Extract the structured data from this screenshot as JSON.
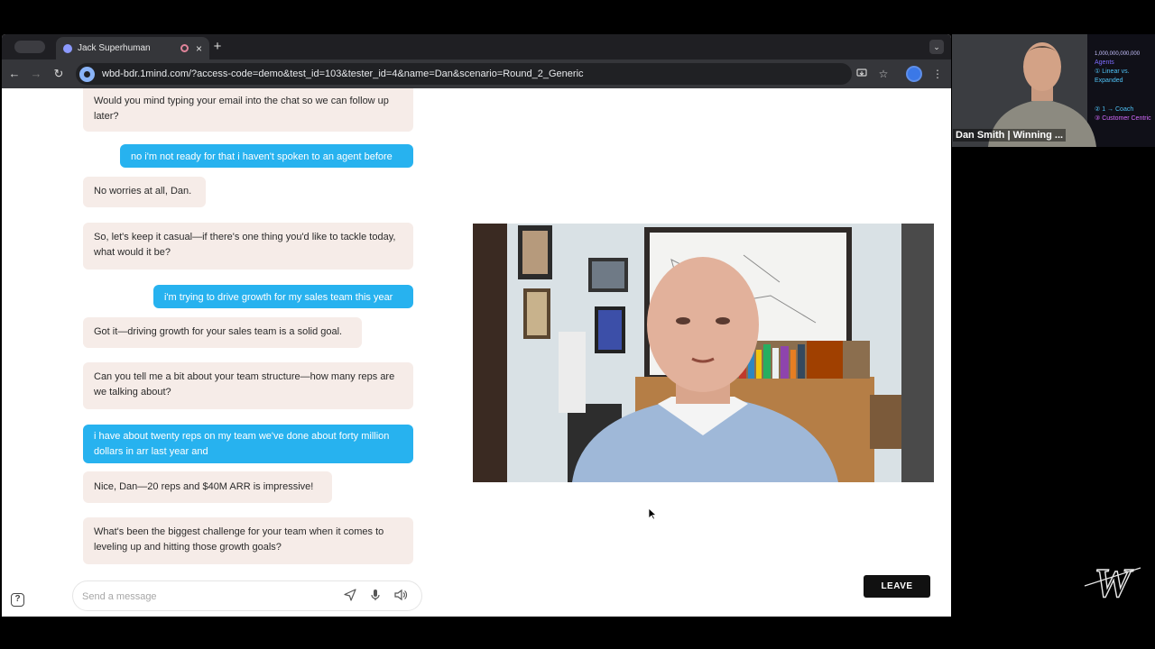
{
  "browser": {
    "tab_title": "Jack Superhuman",
    "tab_close": "×",
    "new_tab": "+",
    "url": "wbd-bdr.1mind.com/?access-code=demo&test_id=103&tester_id=4&name=Dan&scenario=Round_2_Generic"
  },
  "chat": {
    "messages": [
      {
        "role": "bot",
        "text": "Would you mind typing your email into the chat so we can follow up later?"
      },
      {
        "role": "user",
        "text": "no i'm not ready for that i haven't spoken to an agent before"
      },
      {
        "role": "bot",
        "text": "No worries at all, Dan."
      },
      {
        "role": "bot",
        "text": "So, let's keep it casual—if there's one thing you'd like to tackle today, what would it be?"
      },
      {
        "role": "user",
        "text": "i'm trying to drive growth for my sales team this year"
      },
      {
        "role": "bot",
        "text": "Got it—driving growth for your sales team is a solid goal."
      },
      {
        "role": "bot",
        "text": "Can you tell me a bit about your team structure—how many reps are we talking about?"
      },
      {
        "role": "user",
        "text": "i have about twenty reps on my team we've done about forty million dollars in arr last year and"
      },
      {
        "role": "bot",
        "text": "Nice, Dan—20 reps and $40M ARR is impressive!"
      },
      {
        "role": "bot",
        "text": "What's been the biggest challenge for your team when it comes to leveling up and hitting those growth goals?"
      }
    ],
    "composer_placeholder": "Send a message",
    "help_label": "?"
  },
  "call": {
    "leave_label": "LEAVE"
  },
  "presenter": {
    "name": "Dan Smith | Winning ...",
    "whiteboard_lines": [
      "1,000,000,000,000",
      "Agents",
      "① Linear vs. Expanded",
      "② 1 → Coach",
      "③ Customer Centric"
    ]
  },
  "brand": {
    "logo_text": "W"
  },
  "colors": {
    "user_bubble": "#27b2ef",
    "bot_bubble": "#f6ece8",
    "leave_button": "#111111",
    "chrome_dark": "#35363a"
  }
}
